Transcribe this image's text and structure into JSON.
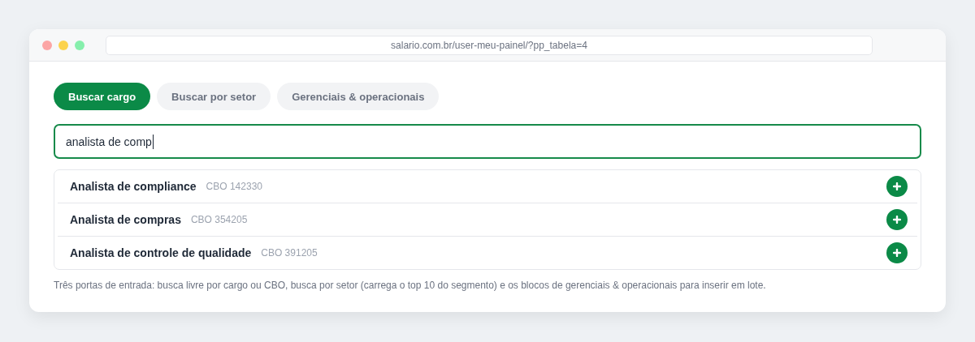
{
  "browser": {
    "url": "salario.com.br/user-meu-painel/?pp_tabela=4"
  },
  "tabs": [
    {
      "label": "Buscar cargo",
      "selected": true
    },
    {
      "label": "Buscar por setor",
      "selected": false
    },
    {
      "label": "Gerenciais & operacionais",
      "selected": false
    }
  ],
  "search": {
    "value": "analista de comp"
  },
  "results": [
    {
      "title": "Analista de compliance",
      "code": "CBO 142330"
    },
    {
      "title": "Analista de compras",
      "code": "CBO 354205"
    },
    {
      "title": "Analista de controle de qualidade",
      "code": "CBO 391205"
    }
  ],
  "caption": "Três portas de entrada: busca livre por cargo ou CBO, busca por setor (carrega o top 10 do segmento) e os blocos de gerenciais & operacionais para inserir em lote."
}
